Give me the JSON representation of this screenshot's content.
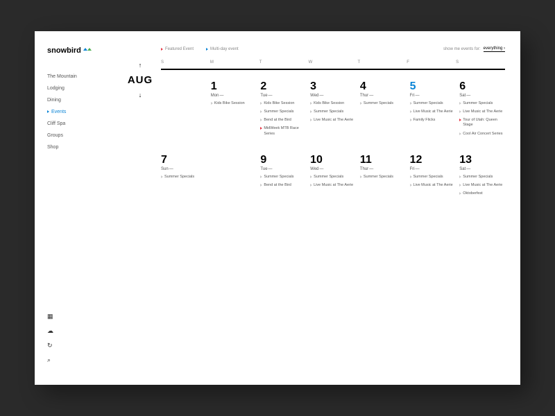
{
  "logo": "snowbird",
  "nav": [
    "The Mountain",
    "Lodging",
    "Dining",
    "Events",
    "Cliff Spa",
    "Groups",
    "Shop"
  ],
  "navActive": 3,
  "month": "AUG",
  "legend": {
    "featured": "Featured Event",
    "multiday": "Multi-day event"
  },
  "filter": {
    "label": "show me events for:",
    "value": "everything"
  },
  "dow": [
    "S",
    "M",
    "T",
    "W",
    "T",
    "F",
    "S"
  ],
  "days": [
    {
      "n": "",
      "name": "",
      "evts": []
    },
    {
      "n": "1",
      "name": "Mon",
      "evts": [
        {
          "t": "Kids Bike Session"
        }
      ]
    },
    {
      "n": "2",
      "name": "Tue",
      "evts": [
        {
          "t": "Kids Bike Session"
        },
        {
          "t": "Summer Specials"
        },
        {
          "t": "Bend at the Bird"
        },
        {
          "t": "MidWeek MTB Race Series",
          "f": "red"
        }
      ]
    },
    {
      "n": "3",
      "name": "Wed",
      "evts": [
        {
          "t": "Kids Bike Session"
        },
        {
          "t": "Summer Specials"
        },
        {
          "t": "Live Music at The Aerie"
        }
      ]
    },
    {
      "n": "4",
      "name": "Thur",
      "evts": [
        {
          "t": "Summer Specials"
        }
      ]
    },
    {
      "n": "5",
      "name": "Fri",
      "hl": true,
      "evts": [
        {
          "t": "Summer Specials"
        },
        {
          "t": "Live Music at The Aerie"
        },
        {
          "t": "Family Flicks"
        }
      ]
    },
    {
      "n": "6",
      "name": "Sat",
      "evts": [
        {
          "t": "Summer Specials"
        },
        {
          "t": "Live Music at The Aerie"
        },
        {
          "t": "Tour of Utah: Queen Stage",
          "f": "red"
        },
        {
          "t": "Cool Air Concert Series"
        }
      ]
    },
    {
      "n": "7",
      "name": "Sun",
      "evts": [
        {
          "t": "Summer Specials"
        }
      ]
    },
    {
      "n": "",
      "name": "",
      "evts": []
    },
    {
      "n": "9",
      "name": "Tue",
      "evts": [
        {
          "t": "Summer Specials"
        },
        {
          "t": "Bend at the Bird"
        }
      ]
    },
    {
      "n": "10",
      "name": "Wed",
      "evts": [
        {
          "t": "Summer Specials"
        },
        {
          "t": "Live Music at The Aerie"
        }
      ]
    },
    {
      "n": "11",
      "name": "Thur",
      "evts": [
        {
          "t": "Summer Specials"
        }
      ]
    },
    {
      "n": "12",
      "name": "Fri",
      "evts": [
        {
          "t": "Summer Specials"
        },
        {
          "t": "Live Music at The Aerie"
        }
      ]
    },
    {
      "n": "13",
      "name": "Sat",
      "evts": [
        {
          "t": "Summer Specials"
        },
        {
          "t": "Live Music at The Aerie"
        },
        {
          "t": "Oktoberfest"
        }
      ]
    }
  ]
}
